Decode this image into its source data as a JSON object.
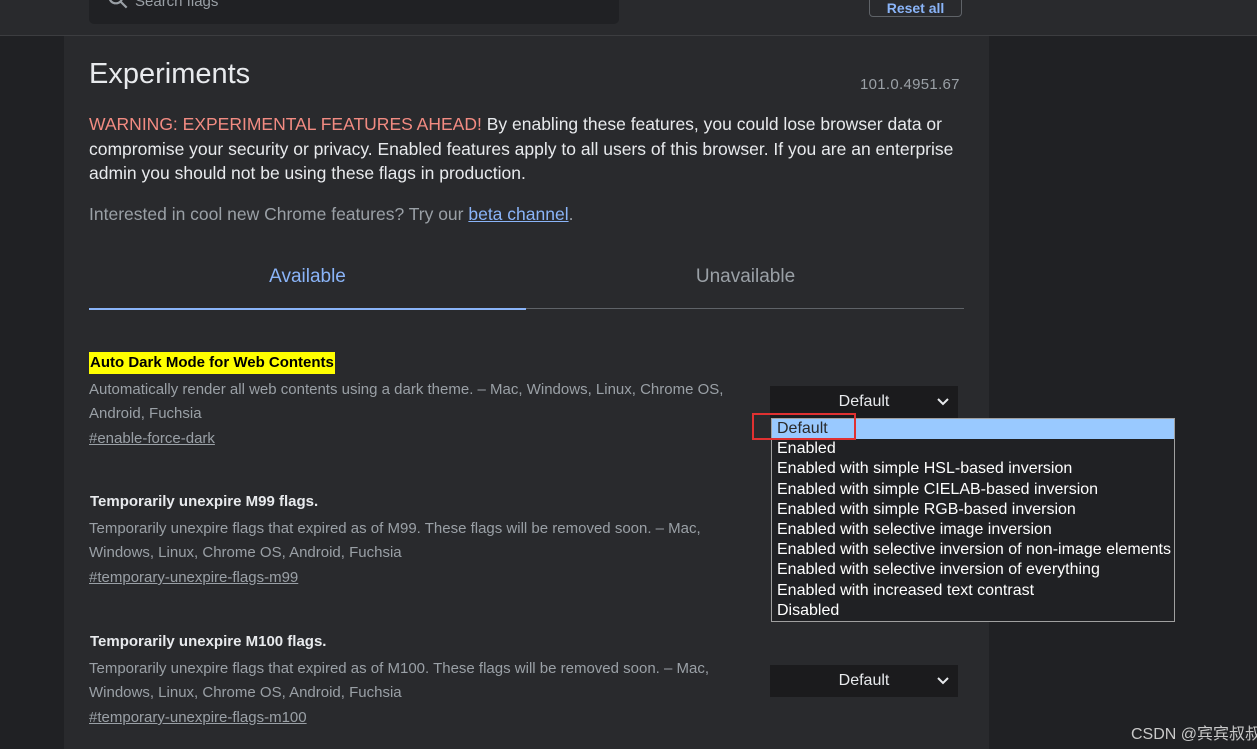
{
  "header": {
    "search_placeholder": "Search flags",
    "reset_label": "Reset all"
  },
  "page": {
    "title": "Experiments",
    "version": "101.0.4951.67",
    "warning_strong": "WARNING: EXPERIMENTAL FEATURES AHEAD!",
    "warning_text": " By enabling these features, you could lose browser data or compromise your security or privacy. Enabled features apply to all users of this browser. If you are an enterprise admin you should not be using these flags in production.",
    "interested_text": "Interested in cool new Chrome features? Try our ",
    "beta_link": "beta channel",
    "interested_end": "."
  },
  "tabs": {
    "available": "Available",
    "unavailable": "Unavailable"
  },
  "flags": [
    {
      "title": "Auto Dark Mode for Web Contents",
      "description": "Automatically render all web contents using a dark theme. – Mac, Windows, Linux, Chrome OS, Android, Fuchsia",
      "link": "#enable-force-dark",
      "value": "Default"
    },
    {
      "title": "Temporarily unexpire M99 flags.",
      "description": "Temporarily unexpire flags that expired as of M99. These flags will be removed soon. – Mac, Windows, Linux, Chrome OS, Android, Fuchsia",
      "link": "#temporary-unexpire-flags-m99"
    },
    {
      "title": "Temporarily unexpire M100 flags.",
      "description": "Temporarily unexpire flags that expired as of M100. These flags will be removed soon. – Mac, Windows, Linux, Chrome OS, Android, Fuchsia",
      "link": "#temporary-unexpire-flags-m100",
      "value": "Default"
    }
  ],
  "dropdown": {
    "options": [
      "Default",
      "Enabled",
      "Enabled with simple HSL-based inversion",
      "Enabled with simple CIELAB-based inversion",
      "Enabled with simple RGB-based inversion",
      "Enabled with selective image inversion",
      "Enabled with selective inversion of non-image elements",
      "Enabled with selective inversion of everything",
      "Enabled with increased text contrast",
      "Disabled"
    ],
    "selected": "Default"
  },
  "watermark": "CSDN @宾宾叔叔",
  "colors": {
    "background": "#202124",
    "panel": "#292a2d",
    "accent": "#8ab4f8",
    "warning": "#f28b82",
    "highlight": "#ffff00",
    "selected_option": "#99c9ff",
    "annotation_box": "#e03131"
  }
}
